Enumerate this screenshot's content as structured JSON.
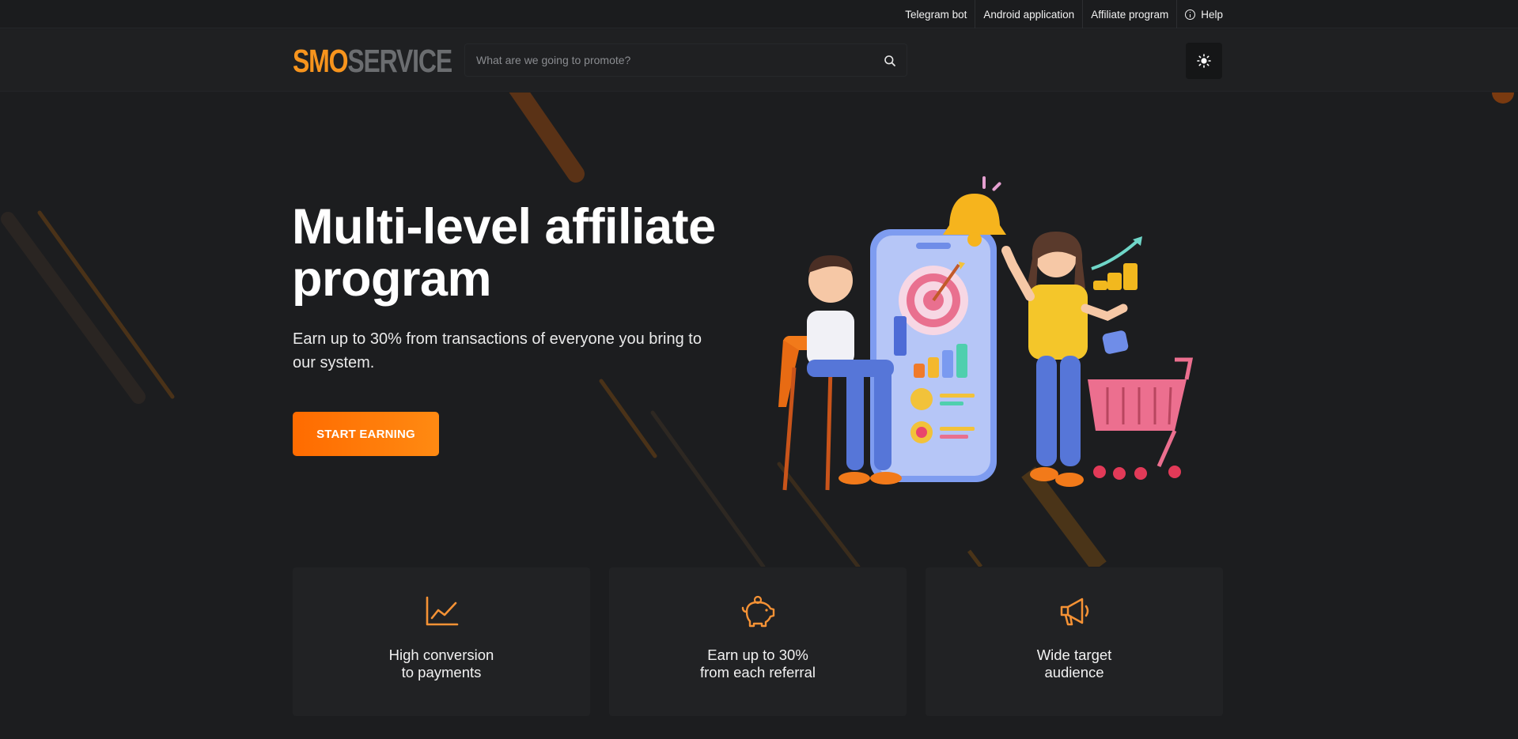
{
  "topbar": {
    "links": [
      {
        "label": "Telegram bot"
      },
      {
        "label": "Android application"
      },
      {
        "label": "Affiliate program"
      },
      {
        "label": "Help"
      }
    ]
  },
  "header": {
    "logo_part1": "SMO",
    "logo_part2": "SERVICE",
    "search_placeholder": "What are we going to promote?",
    "search_icon": "search-icon",
    "theme_icon": "sun-icon"
  },
  "hero": {
    "title": "Multi-level affiliate program",
    "subtitle": "Earn up to 30% from transactions of everyone you bring to our system.",
    "cta_label": "START EARNING"
  },
  "features": [
    {
      "icon": "chart-line-icon",
      "text": "High conversion\nto payments"
    },
    {
      "icon": "piggy-bank-icon",
      "text": "Earn up to 30%\nfrom each referral"
    },
    {
      "icon": "megaphone-icon",
      "text": "Wide target\naudience"
    }
  ],
  "colors": {
    "accent": "#f7941d",
    "cta_start": "#ff6b00",
    "cta_end": "#ff8a12",
    "background": "#1c1d1f",
    "card": "#212224"
  }
}
